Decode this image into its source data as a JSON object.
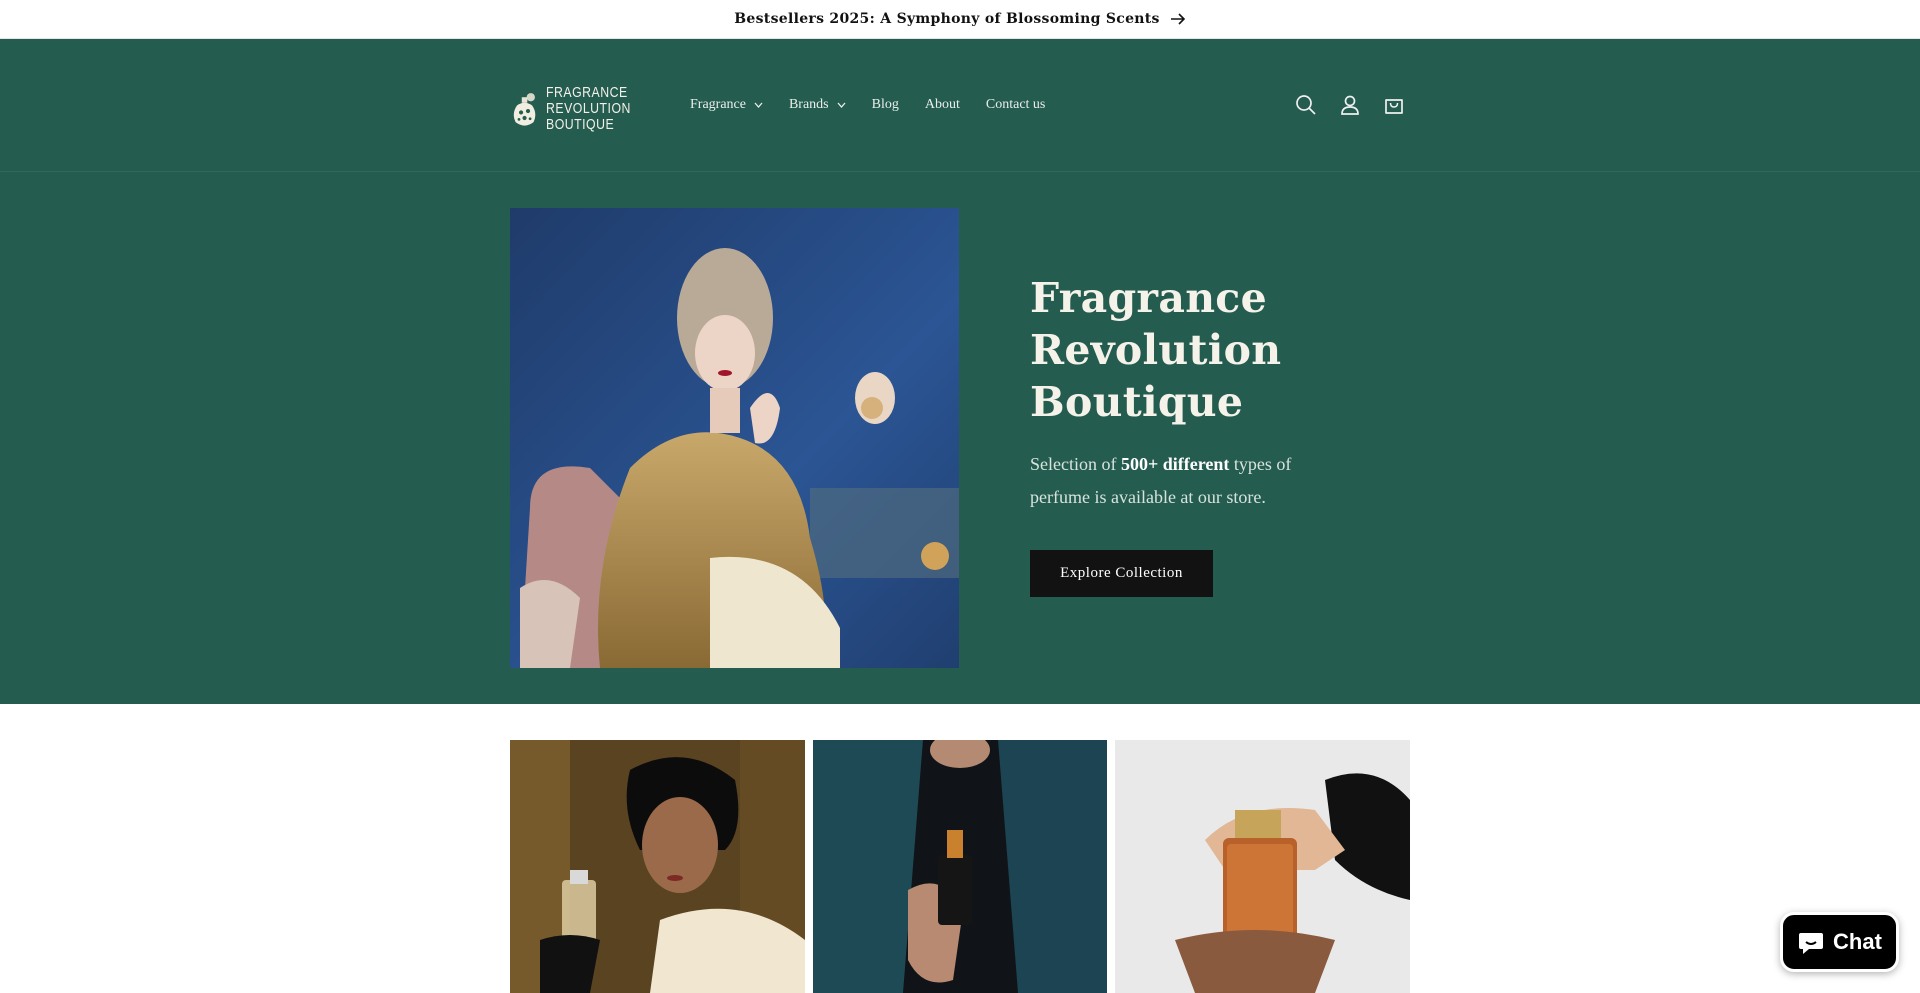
{
  "announcement": {
    "text": "Bestsellers 2025: A Symphony of Blossoming Scents"
  },
  "logo": {
    "line1": "FRAGRANCE",
    "line2": "REVOLUTION",
    "line3": "BOUTIQUE"
  },
  "nav": {
    "items": [
      {
        "label": "Fragrance",
        "dropdown": true
      },
      {
        "label": "Brands",
        "dropdown": true
      },
      {
        "label": "Blog",
        "dropdown": false
      },
      {
        "label": "About",
        "dropdown": false
      },
      {
        "label": "Contact us",
        "dropdown": false
      }
    ]
  },
  "header_icons": [
    "search-icon",
    "account-icon",
    "cart-icon"
  ],
  "hero": {
    "title_line1": "Fragrance",
    "title_line2": "Revolution",
    "title_line3": "Boutique",
    "desc_prefix": "Selection of ",
    "desc_bold": "500+ different",
    "desc_suffix": " types of perfume is available at our store.",
    "button_label": "Explore Collection"
  },
  "chat": {
    "label": "Chat"
  },
  "colors": {
    "brand_green": "#255c50",
    "button_dark": "#121212",
    "text_light": "#f5f2ea"
  }
}
